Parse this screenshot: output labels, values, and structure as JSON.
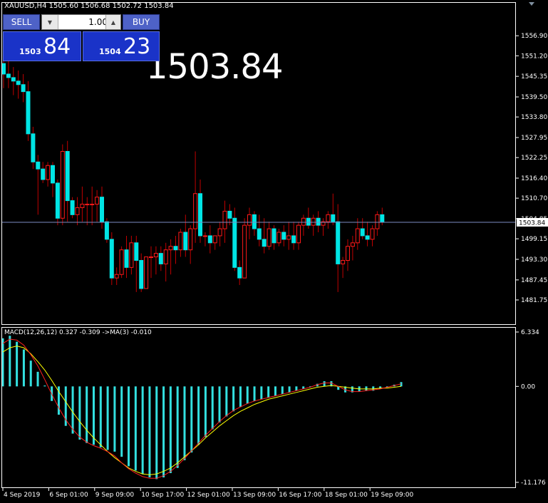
{
  "header": {
    "symbol_line": "XAUUSD,H4  1505.60 1506.68 1502.72 1503.84",
    "big_price": "1503.84"
  },
  "trade_panel": {
    "sell_label": "SELL",
    "buy_label": "BUY",
    "lot_value": "1.00",
    "bid_small": "1503",
    "bid_large": "84",
    "ask_small": "1504",
    "ask_large": "23"
  },
  "macd": {
    "label": "MACD(12,26,12) 0.327 -0.309 ->MA(3) -0.010"
  },
  "colors": {
    "bull": "#ff1a1a",
    "bear": "#00e5e5",
    "wick": "#c00000",
    "histogram": "#33e0e0",
    "signal": "#ffff00",
    "ma": "#ff2020",
    "current_line": "#7d8cc4",
    "axis": "#ffffff"
  },
  "chart_data": [
    {
      "type": "candlestick",
      "title": "XAUUSD,H4",
      "ylim": [
        1481.75,
        1562.0
      ],
      "y_ticks": [
        "1556.90",
        "1551.20",
        "1545.35",
        "1539.50",
        "1533.80",
        "1527.95",
        "1522.25",
        "1516.40",
        "1510.70",
        "1504.85",
        "1499.15",
        "1493.30",
        "1487.45",
        "1481.75"
      ],
      "x_ticks": [
        "4 Sep 2019",
        "6 Sep 01:00",
        "9 Sep 09:00",
        "10 Sep 17:00",
        "12 Sep 01:00",
        "13 Sep 09:00",
        "16 Sep 17:00",
        "18 Sep 01:00",
        "19 Sep 09:00"
      ],
      "current_price": 1503.84,
      "current_price_label": "1503.84",
      "ohlc": [
        [
          1549,
          1553,
          1542,
          1546
        ],
        [
          1546,
          1550,
          1542,
          1545
        ],
        [
          1545,
          1548,
          1540,
          1544
        ],
        [
          1544,
          1547,
          1539,
          1543
        ],
        [
          1543,
          1546,
          1538,
          1541
        ],
        [
          1541,
          1544,
          1527,
          1529
        ],
        [
          1529,
          1531,
          1519,
          1521
        ],
        [
          1521,
          1523,
          1506,
          1519
        ],
        [
          1519,
          1521,
          1515,
          1516
        ],
        [
          1516,
          1521,
          1514,
          1520
        ],
        [
          1520,
          1521,
          1511,
          1515
        ],
        [
          1515,
          1516,
          1503,
          1505
        ],
        [
          1505,
          1526,
          1503,
          1524
        ],
        [
          1524,
          1527,
          1504,
          1510
        ],
        [
          1510,
          1511,
          1505,
          1506
        ],
        [
          1506,
          1511,
          1503,
          1508
        ],
        [
          1508,
          1514,
          1504,
          1509
        ],
        [
          1509,
          1511,
          1503,
          1509
        ],
        [
          1509,
          1514,
          1503,
          1509
        ],
        [
          1509,
          1513,
          1504,
          1511
        ],
        [
          1511,
          1514,
          1502,
          1504
        ],
        [
          1504,
          1505,
          1498,
          1499
        ],
        [
          1499,
          1501,
          1486,
          1488
        ],
        [
          1488,
          1491,
          1486,
          1489
        ],
        [
          1489,
          1497,
          1488,
          1496
        ],
        [
          1496,
          1500,
          1488,
          1491
        ],
        [
          1491,
          1500,
          1489,
          1498
        ],
        [
          1498,
          1500,
          1484,
          1493
        ],
        [
          1493,
          1495,
          1484,
          1485
        ],
        [
          1485,
          1494,
          1485,
          1494
        ],
        [
          1494,
          1497,
          1488,
          1494
        ],
        [
          1494,
          1497,
          1489,
          1495
        ],
        [
          1495,
          1497,
          1490,
          1492
        ],
        [
          1492,
          1498,
          1487,
          1496
        ],
        [
          1496,
          1499,
          1489,
          1497
        ],
        [
          1497,
          1500,
          1492,
          1496
        ],
        [
          1496,
          1502,
          1494,
          1501
        ],
        [
          1501,
          1506,
          1494,
          1496
        ],
        [
          1496,
          1503,
          1492,
          1502
        ],
        [
          1502,
          1524,
          1498,
          1512
        ],
        [
          1512,
          1516,
          1498,
          1500
        ],
        [
          1500,
          1501,
          1497,
          1500
        ],
        [
          1500,
          1503,
          1495,
          1498
        ],
        [
          1498,
          1500,
          1496,
          1500
        ],
        [
          1500,
          1504,
          1497,
          1502
        ],
        [
          1502,
          1510,
          1498,
          1507
        ],
        [
          1507,
          1509,
          1503,
          1505
        ],
        [
          1505,
          1508,
          1490,
          1491
        ],
        [
          1491,
          1493,
          1486,
          1488
        ],
        [
          1488,
          1505,
          1488,
          1503
        ],
        [
          1503,
          1508,
          1499,
          1506
        ],
        [
          1506,
          1507,
          1500,
          1502
        ],
        [
          1502,
          1506,
          1497,
          1499
        ],
        [
          1499,
          1505,
          1495,
          1497
        ],
        [
          1497,
          1504,
          1496,
          1502
        ],
        [
          1502,
          1503,
          1496,
          1498
        ],
        [
          1498,
          1502,
          1497,
          1501
        ],
        [
          1501,
          1503,
          1497,
          1499
        ],
        [
          1499,
          1504,
          1496,
          1500
        ],
        [
          1500,
          1504,
          1496,
          1498
        ],
        [
          1498,
          1504,
          1496,
          1503
        ],
        [
          1503,
          1506,
          1500,
          1505
        ],
        [
          1505,
          1508,
          1502,
          1503
        ],
        [
          1503,
          1506,
          1500,
          1505
        ],
        [
          1505,
          1507,
          1501,
          1503
        ],
        [
          1503,
          1505,
          1500,
          1504
        ],
        [
          1504,
          1507,
          1502,
          1506
        ],
        [
          1506,
          1512,
          1503,
          1504
        ],
        [
          1504,
          1509,
          1484,
          1492
        ],
        [
          1492,
          1494,
          1488,
          1493
        ],
        [
          1493,
          1499,
          1490,
          1497
        ],
        [
          1497,
          1500,
          1493,
          1498
        ],
        [
          1498,
          1505,
          1496,
          1502
        ],
        [
          1502,
          1505,
          1499,
          1500
        ],
        [
          1500,
          1504,
          1497,
          1499
        ],
        [
          1499,
          1503,
          1497,
          1502
        ],
        [
          1502,
          1507,
          1500,
          1506
        ],
        [
          1506,
          1508,
          1503,
          1504
        ]
      ]
    },
    {
      "type": "bar",
      "title": "MACD(12,26,12) 0.327 -0.309 ->MA(3) -0.010",
      "ylim": [
        -11.176,
        6.334
      ],
      "y_ticks": [
        "6.334",
        "0.00",
        "-11.176"
      ],
      "histogram": [
        5.6,
        5.9,
        5.2,
        4.3,
        3.0,
        1.7,
        0.1,
        -1.7,
        -3.3,
        -4.6,
        -5.5,
        -6.2,
        -6.6,
        -6.8,
        -7.1,
        -7.4,
        -7.6,
        -8.2,
        -9.3,
        -9.8,
        -10.2,
        -10.6,
        -10.8,
        -10.6,
        -10.1,
        -9.5,
        -8.6,
        -7.7,
        -6.8,
        -5.9,
        -5.0,
        -4.2,
        -3.5,
        -2.9,
        -2.4,
        -2.0,
        -1.7,
        -1.5,
        -1.3,
        -1.1,
        -0.9,
        -0.7,
        -0.5,
        -0.3,
        -0.1,
        0.3,
        0.6,
        0.6,
        -0.4,
        -0.7,
        -0.7,
        -0.6,
        -0.5,
        -0.5,
        -0.3,
        -0.1,
        0.2,
        0.5
      ],
      "signal": [
        4.0,
        4.5,
        4.7,
        4.5,
        3.8,
        2.9,
        1.9,
        0.7,
        -0.6,
        -1.8,
        -3.0,
        -4.1,
        -5.1,
        -6.0,
        -6.8,
        -7.6,
        -8.3,
        -8.9,
        -9.5,
        -9.9,
        -10.2,
        -10.3,
        -10.2,
        -9.9,
        -9.5,
        -8.9,
        -8.2,
        -7.5,
        -6.8,
        -6.0,
        -5.3,
        -4.6,
        -4.0,
        -3.4,
        -2.9,
        -2.5,
        -2.1,
        -1.8,
        -1.5,
        -1.3,
        -1.1,
        -0.9,
        -0.7,
        -0.5,
        -0.3,
        -0.1,
        0.0,
        0.1,
        0.0,
        -0.1,
        -0.2,
        -0.3,
        -0.3,
        -0.3,
        -0.2,
        -0.2,
        -0.1,
        0.0
      ],
      "ma": [
        5.0,
        5.5,
        5.4,
        4.8,
        3.7,
        2.4,
        0.8,
        -0.9,
        -2.5,
        -3.9,
        -5.0,
        -5.9,
        -6.5,
        -6.9,
        -7.2,
        -7.6,
        -8.1,
        -8.9,
        -9.6,
        -10.1,
        -10.5,
        -10.7,
        -10.7,
        -10.4,
        -9.9,
        -9.2,
        -8.4,
        -7.5,
        -6.6,
        -5.7,
        -4.9,
        -4.1,
        -3.4,
        -2.8,
        -2.4,
        -2.0,
        -1.7,
        -1.5,
        -1.3,
        -1.1,
        -0.9,
        -0.7,
        -0.5,
        -0.3,
        -0.1,
        0.2,
        0.4,
        0.4,
        0.0,
        -0.4,
        -0.6,
        -0.6,
        -0.5,
        -0.4,
        -0.3,
        -0.1,
        0.1,
        0.3
      ]
    }
  ]
}
